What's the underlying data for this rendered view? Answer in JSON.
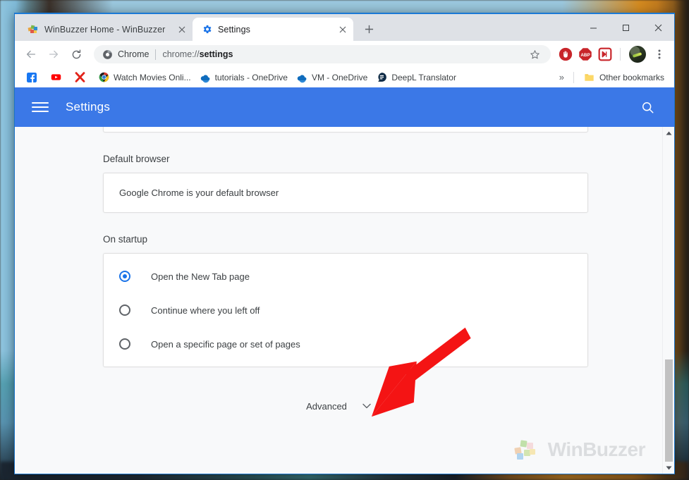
{
  "window": {
    "controls": {
      "minimize": "minimize",
      "maximize": "maximize",
      "close": "close"
    }
  },
  "tabs": [
    {
      "title": "WinBuzzer Home - WinBuzzer",
      "favicon": "winbuzzer-icon",
      "active": false,
      "close": "close-tab-icon"
    },
    {
      "title": "Settings",
      "favicon": "settings-gear-icon",
      "active": true,
      "close": "close-tab-icon"
    }
  ],
  "newtab_label": "+",
  "toolbar": {
    "back": "back-arrow-icon",
    "forward": "forward-arrow-icon",
    "reload": "reload-icon",
    "chrome_badge_label": "Chrome",
    "url_prefix": "chrome://",
    "url_bold": "settings",
    "bookmark_star": "star-icon",
    "extensions": [
      "ublock-origin-icon",
      "adblock-plus-icon",
      "video-downloader-icon"
    ],
    "avatar": "profile-avatar",
    "menu": "three-dot-menu-icon"
  },
  "bookmarks": {
    "items": [
      {
        "label": "",
        "icon": "facebook-icon"
      },
      {
        "label": "",
        "icon": "youtube-icon"
      },
      {
        "label": "",
        "icon": "x-red-icon"
      },
      {
        "label": "Watch Movies Onli...",
        "icon": "chrome-circle-icon"
      },
      {
        "label": "tutorials - OneDrive",
        "icon": "onedrive-cloud-icon"
      },
      {
        "label": "VM - OneDrive",
        "icon": "onedrive-cloud-icon"
      },
      {
        "label": "DeepL Translator",
        "icon": "deepl-icon"
      }
    ],
    "overflow": "»",
    "other_bookmarks": {
      "label": "Other bookmarks",
      "icon": "folder-icon"
    }
  },
  "settings": {
    "menu_icon": "hamburger-menu-icon",
    "title": "Settings",
    "search_icon": "search-icon",
    "sections": [
      {
        "label": "Default browser",
        "type": "text",
        "rows": [
          {
            "text": "Google Chrome is your default browser"
          }
        ]
      },
      {
        "label": "On startup",
        "type": "radio",
        "rows": [
          {
            "text": "Open the New Tab page",
            "checked": true
          },
          {
            "text": "Continue where you left off",
            "checked": false
          },
          {
            "text": "Open a specific page or set of pages",
            "checked": false
          }
        ]
      }
    ],
    "advanced": {
      "label": "Advanced",
      "caret": "chevron-down-icon"
    }
  },
  "watermark": {
    "text": "WinBuzzer"
  },
  "scrollbar": {
    "up": "scroll-up-arrow",
    "down": "scroll-down-arrow"
  },
  "annotation": {
    "type": "red-arrow",
    "points_to": "Advanced"
  },
  "colors": {
    "settings_header": "#3b78e7",
    "accent_blue": "#1a73e8",
    "annotation_red": "#f41414",
    "window_frame": "#dee1e6"
  }
}
